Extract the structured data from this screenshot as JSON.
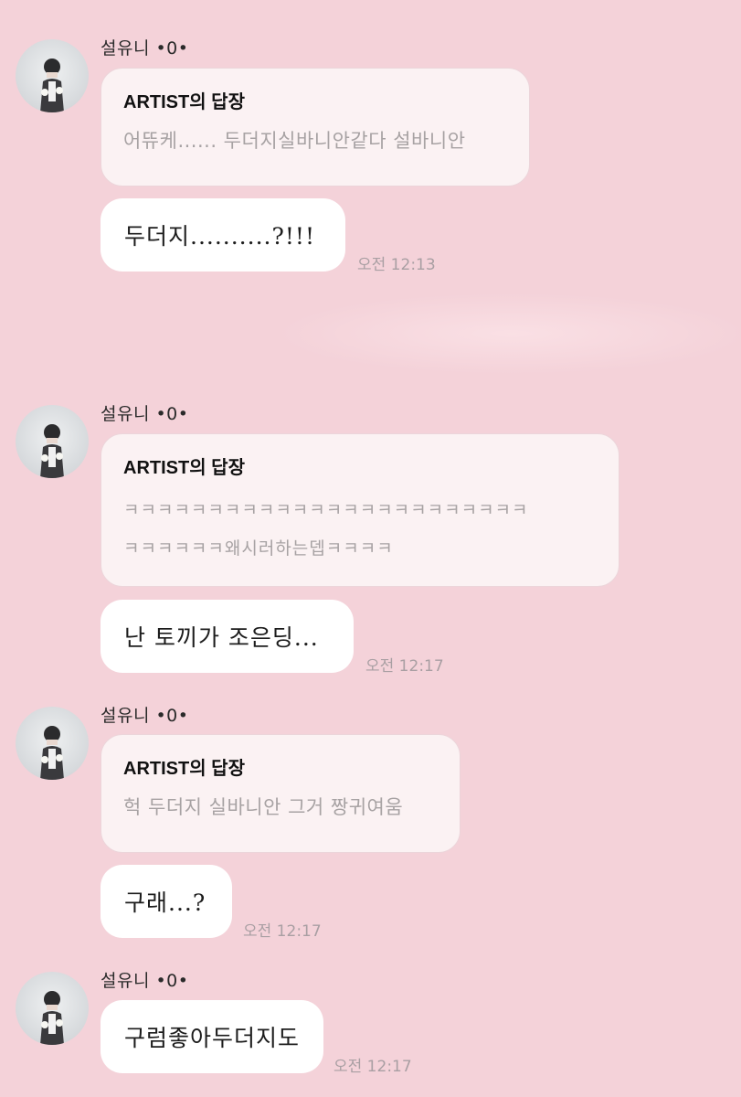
{
  "chat": {
    "messages": [
      {
        "sender": "설유니 •0•",
        "reply_title": "ARTIST의 답장",
        "reply_text": "어뜌케...... 두더지실바니안같다 설바니안",
        "message": "두더지..........?!!!",
        "time": "오전 12:13"
      },
      {
        "sender": "설유니 •0•",
        "reply_title": "ARTIST의 답장",
        "reply_text": "ㅋㅋㅋㅋㅋㅋㅋㅋㅋㅋㅋㅋㅋㅋㅋㅋㅋㅋㅋㅋㅋㅋㅋㅋ\nㅋㅋㅋㅋㅋㅋ왜시러하는뎁ㅋㅋㅋㅋ",
        "message": "난 토끼가 조은딩...",
        "time": "오전 12:17"
      },
      {
        "sender": "설유니 •0•",
        "reply_title": "ARTIST의 답장",
        "reply_text": "헉 두더지 실바니안 그거 짱귀여움",
        "message": "구래...?",
        "time": "오전 12:17"
      },
      {
        "sender": "설유니 •0•",
        "message": "구럼좋아두더지도",
        "time": "오전 12:17"
      }
    ]
  }
}
